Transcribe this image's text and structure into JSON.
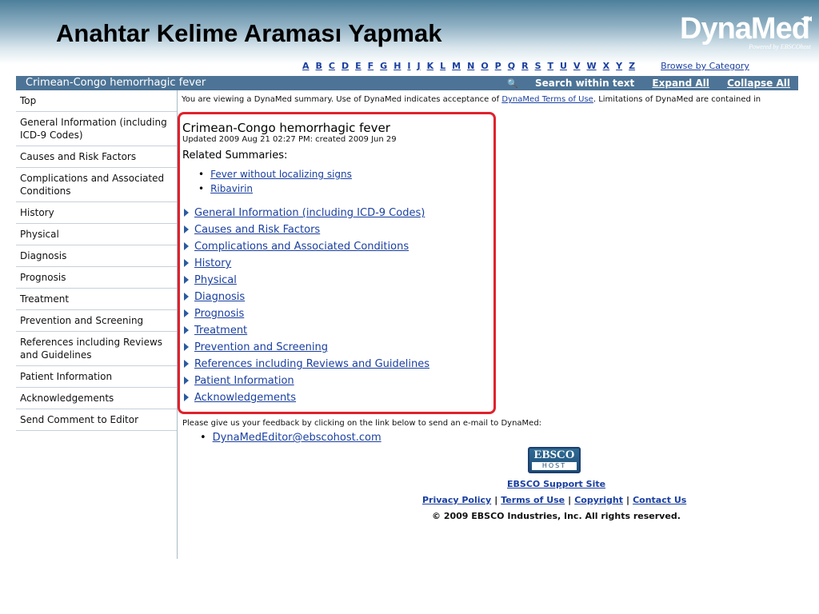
{
  "slide": {
    "title": "Anahtar Kelime Araması Yapmak"
  },
  "logo": {
    "text": "DynaMed",
    "tagline": "Powered by EBSCOhost",
    "arrows": "◂◂◂"
  },
  "alphabet": {
    "letters": [
      "A",
      "B",
      "C",
      "D",
      "E",
      "F",
      "G",
      "H",
      "I",
      "J",
      "K",
      "L",
      "M",
      "N",
      "O",
      "P",
      "Q",
      "R",
      "S",
      "T",
      "U",
      "V",
      "W",
      "X",
      "Y",
      "Z"
    ],
    "browse_label": "Browse by Category"
  },
  "titlebar": {
    "topic": "Crimean-Congo hemorrhagic fever",
    "search_label": "Search within text",
    "expand_label": "Expand All",
    "collapse_label": "Collapse All"
  },
  "sidebar": {
    "items": [
      "Top",
      "General Information (including ICD-9 Codes)",
      "Causes and Risk Factors",
      "Complications and Associated Conditions",
      "History",
      "Physical",
      "Diagnosis",
      "Prognosis",
      "Treatment",
      "Prevention and Screening",
      "References including Reviews and Guidelines",
      "Patient Information",
      "Acknowledgements",
      "Send Comment to Editor"
    ]
  },
  "disclaimer": {
    "prefix": "You are viewing a DynaMed summary. Use of DynaMed indicates acceptance of ",
    "link": "DynaMed Terms of Use",
    "suffix": ". Limitations of DynaMed are contained in"
  },
  "summary": {
    "title": "Crimean-Congo hemorrhagic fever",
    "meta": "Updated 2009 Aug 21 02:27 PM: created 2009 Jun 29",
    "related_heading": "Related Summaries:",
    "related": [
      "Fever without localizing signs",
      "Ribavirin"
    ],
    "sections": [
      "General Information (including ICD-9 Codes)",
      "Causes and Risk Factors",
      "Complications and Associated Conditions",
      "History",
      "Physical",
      "Diagnosis",
      "Prognosis",
      "Treatment",
      "Prevention and Screening",
      "References including Reviews and Guidelines",
      "Patient Information",
      "Acknowledgements"
    ]
  },
  "feedback": {
    "text": "Please give us your feedback by clicking on the link below to send an e-mail to DynaMed:",
    "email": "DynaMedEditor@ebscohost.com"
  },
  "footer": {
    "logo_top": "EBSCO",
    "logo_bottom": "HOST",
    "support": "EBSCO Support Site",
    "links": [
      "Privacy Policy",
      "Terms of Use",
      "Copyright",
      "Contact Us"
    ],
    "separator": "|",
    "copyright": "© 2009 EBSCO Industries, Inc. All rights reserved."
  },
  "colors": {
    "title_bar": "#4d7496",
    "link": "#1a3fa0",
    "highlight_border": "#e0212b",
    "header_gradient_top": "#4d7f9b"
  }
}
